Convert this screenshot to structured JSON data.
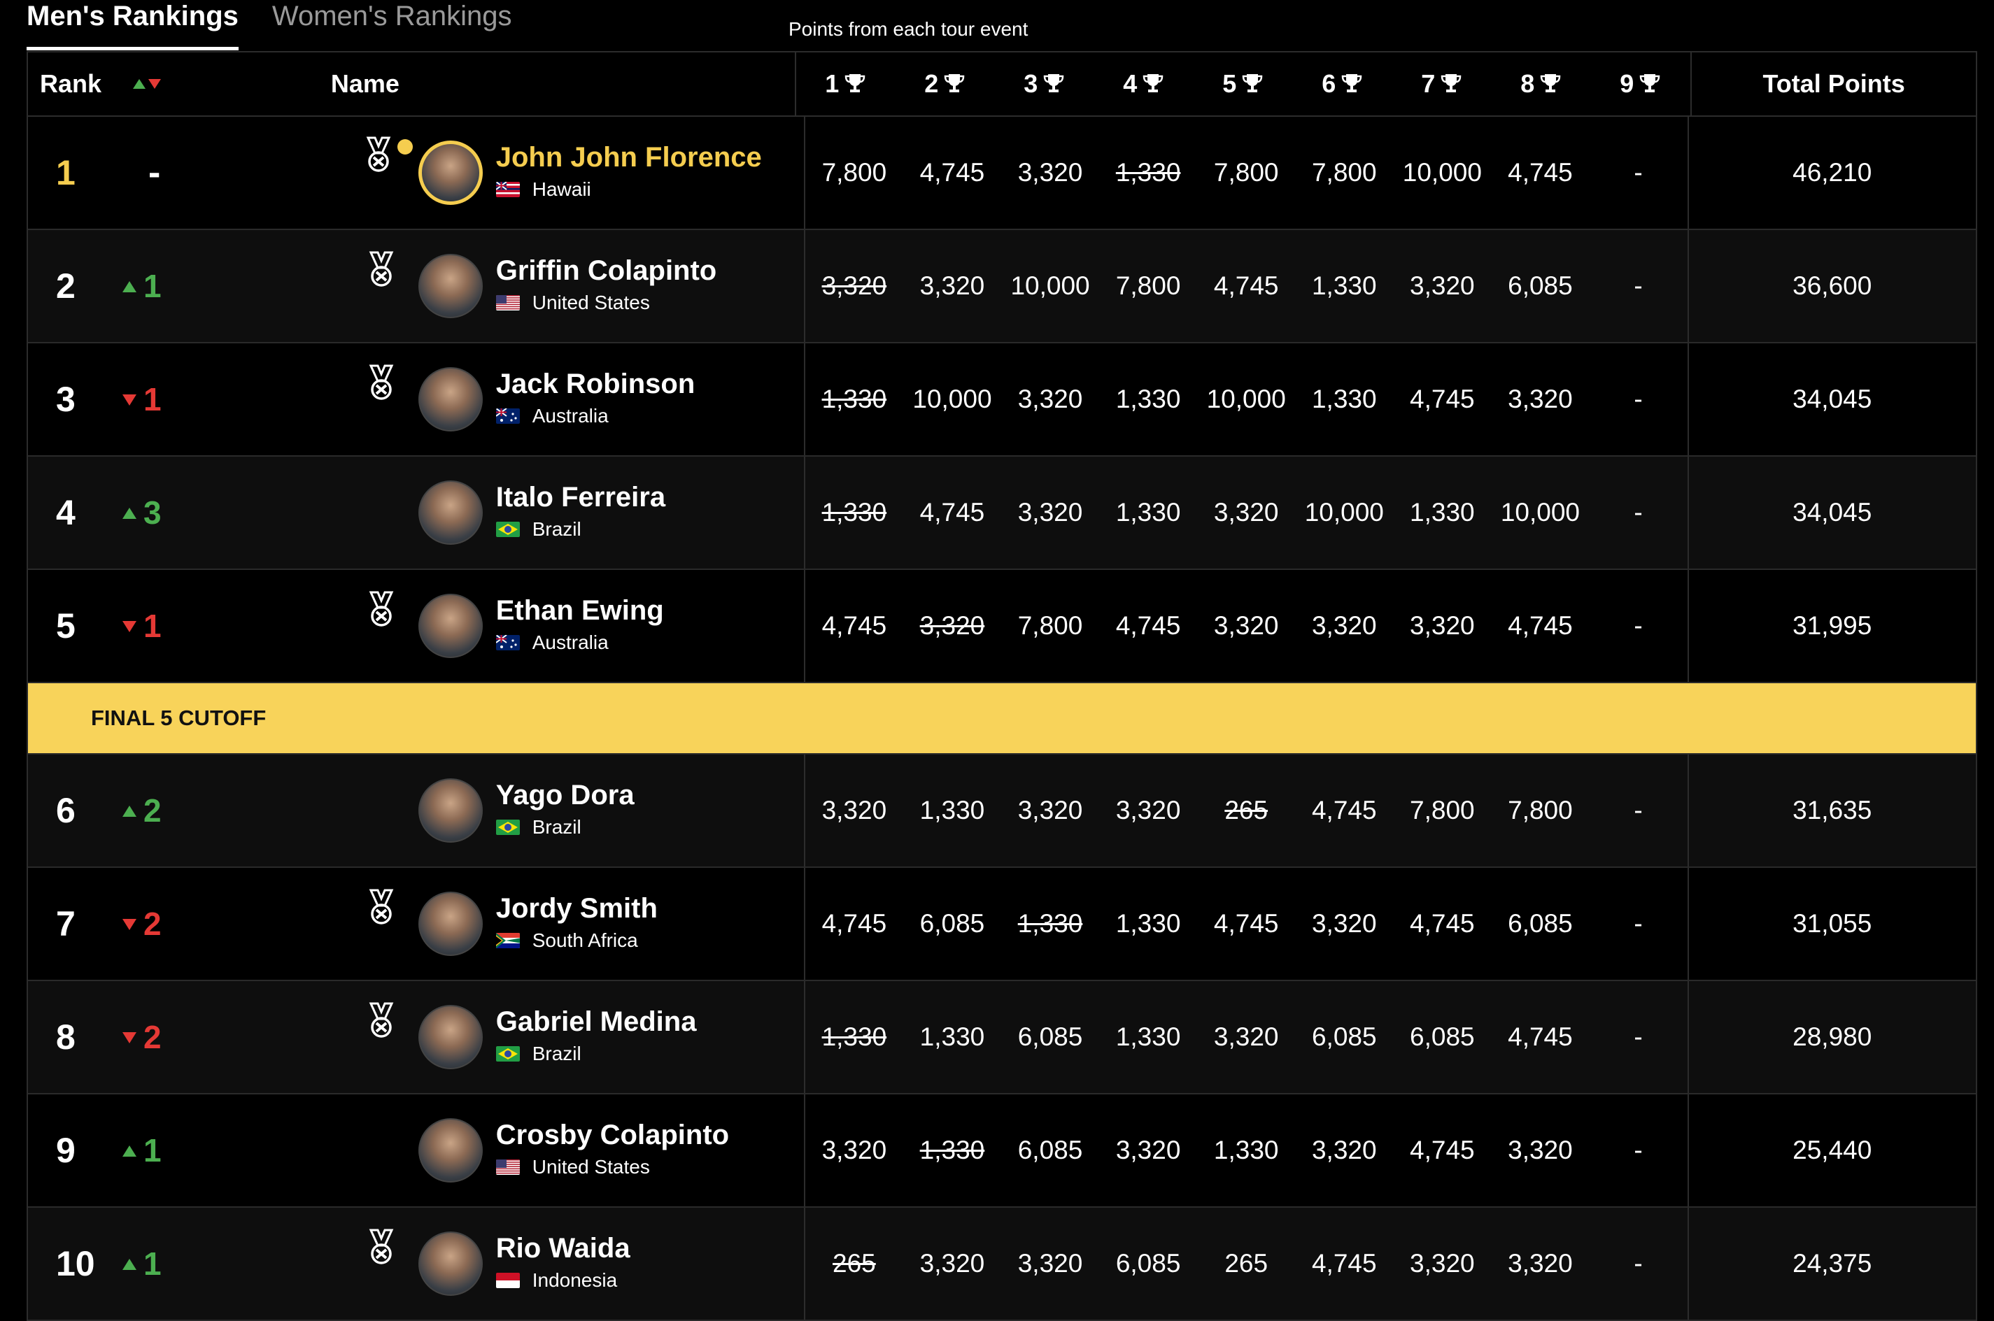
{
  "tabs": [
    {
      "label": "Men's Rankings",
      "active": true
    },
    {
      "label": "Women's Rankings",
      "active": false
    }
  ],
  "subtitle": "Points from each tour event",
  "header": {
    "rank": "Rank",
    "name": "Name",
    "events": [
      "1",
      "2",
      "3",
      "4",
      "5",
      "6",
      "7",
      "8",
      "9"
    ],
    "total": "Total Points"
  },
  "cutoff_label": "FINAL 5 CUTOFF",
  "colors": {
    "gold": "#f5cd4f",
    "up": "#4caf50",
    "down": "#e53935",
    "cutoff_bg": "#f8d35a"
  },
  "rows": [
    {
      "rank": "1",
      "change": "-",
      "dir": "none",
      "medal": true,
      "leader": true,
      "name": "John John Florence",
      "country": "Hawaii",
      "flag": "hawaii",
      "points": [
        "7,800",
        "4,745",
        "3,320",
        "1,330",
        "7,800",
        "7,800",
        "10,000",
        "4,745",
        "-"
      ],
      "dropped": [
        3
      ],
      "total": "46,210"
    },
    {
      "rank": "2",
      "change": "1",
      "dir": "up",
      "medal": true,
      "name": "Griffin Colapinto",
      "country": "United States",
      "flag": "us",
      "points": [
        "3,320",
        "3,320",
        "10,000",
        "7,800",
        "4,745",
        "1,330",
        "3,320",
        "6,085",
        "-"
      ],
      "dropped": [
        0
      ],
      "total": "36,600"
    },
    {
      "rank": "3",
      "change": "1",
      "dir": "down",
      "medal": true,
      "name": "Jack Robinson",
      "country": "Australia",
      "flag": "au",
      "points": [
        "1,330",
        "10,000",
        "3,320",
        "1,330",
        "10,000",
        "1,330",
        "4,745",
        "3,320",
        "-"
      ],
      "dropped": [
        0
      ],
      "total": "34,045"
    },
    {
      "rank": "4",
      "change": "3",
      "dir": "up",
      "medal": false,
      "name": "Italo Ferreira",
      "country": "Brazil",
      "flag": "br",
      "points": [
        "1,330",
        "4,745",
        "3,320",
        "1,330",
        "3,320",
        "10,000",
        "1,330",
        "10,000",
        "-"
      ],
      "dropped": [
        0
      ],
      "total": "34,045"
    },
    {
      "rank": "5",
      "change": "1",
      "dir": "down",
      "medal": true,
      "name": "Ethan Ewing",
      "country": "Australia",
      "flag": "au",
      "points": [
        "4,745",
        "3,320",
        "7,800",
        "4,745",
        "3,320",
        "3,320",
        "3,320",
        "4,745",
        "-"
      ],
      "dropped": [
        1
      ],
      "total": "31,995"
    },
    {
      "rank": "6",
      "change": "2",
      "dir": "up",
      "medal": false,
      "name": "Yago Dora",
      "country": "Brazil",
      "flag": "br",
      "points": [
        "3,320",
        "1,330",
        "3,320",
        "3,320",
        "265",
        "4,745",
        "7,800",
        "7,800",
        "-"
      ],
      "dropped": [
        4
      ],
      "total": "31,635"
    },
    {
      "rank": "7",
      "change": "2",
      "dir": "down",
      "medal": true,
      "name": "Jordy Smith",
      "country": "South Africa",
      "flag": "za",
      "points": [
        "4,745",
        "6,085",
        "1,330",
        "1,330",
        "4,745",
        "3,320",
        "4,745",
        "6,085",
        "-"
      ],
      "dropped": [
        2
      ],
      "total": "31,055"
    },
    {
      "rank": "8",
      "change": "2",
      "dir": "down",
      "medal": true,
      "name": "Gabriel Medina",
      "country": "Brazil",
      "flag": "br",
      "points": [
        "1,330",
        "1,330",
        "6,085",
        "1,330",
        "3,320",
        "6,085",
        "6,085",
        "4,745",
        "-"
      ],
      "dropped": [
        0
      ],
      "total": "28,980"
    },
    {
      "rank": "9",
      "change": "1",
      "dir": "up",
      "medal": false,
      "name": "Crosby Colapinto",
      "country": "United States",
      "flag": "us",
      "points": [
        "3,320",
        "1,330",
        "6,085",
        "3,320",
        "1,330",
        "3,320",
        "4,745",
        "3,320",
        "-"
      ],
      "dropped": [
        1
      ],
      "total": "25,440"
    },
    {
      "rank": "10",
      "change": "1",
      "dir": "up",
      "medal": true,
      "name": "Rio Waida",
      "country": "Indonesia",
      "flag": "id",
      "points": [
        "265",
        "3,320",
        "3,320",
        "6,085",
        "265",
        "4,745",
        "3,320",
        "3,320",
        "-"
      ],
      "dropped": [
        0
      ],
      "total": "24,375"
    }
  ]
}
